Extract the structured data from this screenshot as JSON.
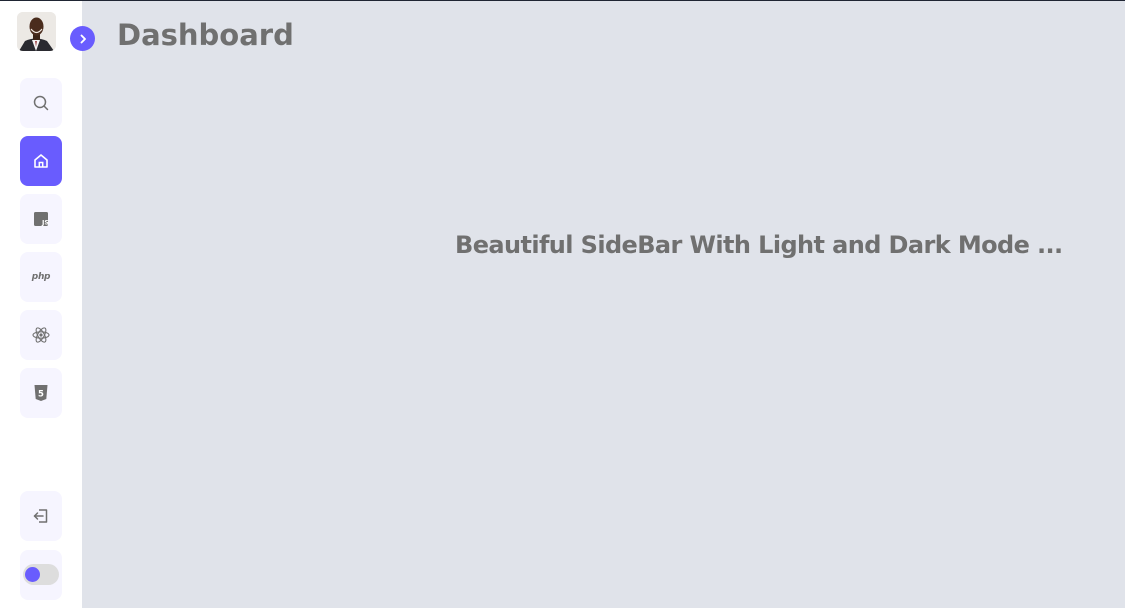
{
  "header": {
    "title": "Dashboard"
  },
  "main": {
    "text": "Beautiful SideBar With Light and Dark Mode ..."
  },
  "sidebar": {
    "avatar": "user-avatar",
    "toggle_icon": "chevron-right-icon",
    "items": [
      {
        "icon": "search-icon",
        "active": false
      },
      {
        "icon": "home-icon",
        "active": true
      },
      {
        "icon": "javascript-icon",
        "label": "JS",
        "active": false
      },
      {
        "icon": "php-icon",
        "label": "php",
        "active": false
      },
      {
        "icon": "react-icon",
        "active": false
      },
      {
        "icon": "html5-icon",
        "label": "5",
        "active": false
      }
    ],
    "logout_icon": "logout-icon",
    "dark_mode_switch": {
      "on": false
    }
  },
  "colors": {
    "accent": "#695cfe",
    "main_bg": "#e0e3ea",
    "sidebar_bg": "#ffffff",
    "item_bg": "#f6f5ff",
    "text": "#707070"
  }
}
